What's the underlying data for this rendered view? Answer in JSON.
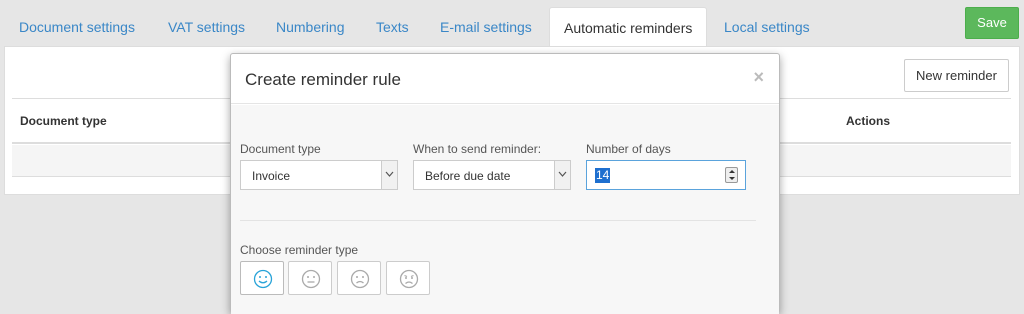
{
  "tabs": [
    {
      "label": "Document settings"
    },
    {
      "label": "VAT settings"
    },
    {
      "label": "Numbering"
    },
    {
      "label": "Texts"
    },
    {
      "label": "E-mail settings"
    },
    {
      "label": "Automatic reminders",
      "active": true
    },
    {
      "label": "Local settings"
    }
  ],
  "toolbar": {
    "save_label": "Save"
  },
  "panel": {
    "new_reminder_label": "New reminder",
    "columns": {
      "document_type": "Document type",
      "actions": "Actions"
    }
  },
  "modal": {
    "title": "Create reminder rule",
    "close_symbol": "×",
    "document_type": {
      "label": "Document type",
      "value": "Invoice"
    },
    "when": {
      "label": "When to send reminder:",
      "value": "Before due date"
    },
    "days": {
      "label": "Number of days",
      "value": "14"
    },
    "reminder_type": {
      "label": "Choose reminder type",
      "options": [
        {
          "icon": "smile-icon",
          "selected": true
        },
        {
          "icon": "neutral-face-icon",
          "selected": false
        },
        {
          "icon": "frown-icon",
          "selected": false
        },
        {
          "icon": "angry-face-icon",
          "selected": false
        }
      ]
    }
  },
  "colors": {
    "link": "#3a87c7",
    "save": "#5cb85c",
    "focus": "#5aa3dc",
    "active_icon": "#29a3d8"
  }
}
